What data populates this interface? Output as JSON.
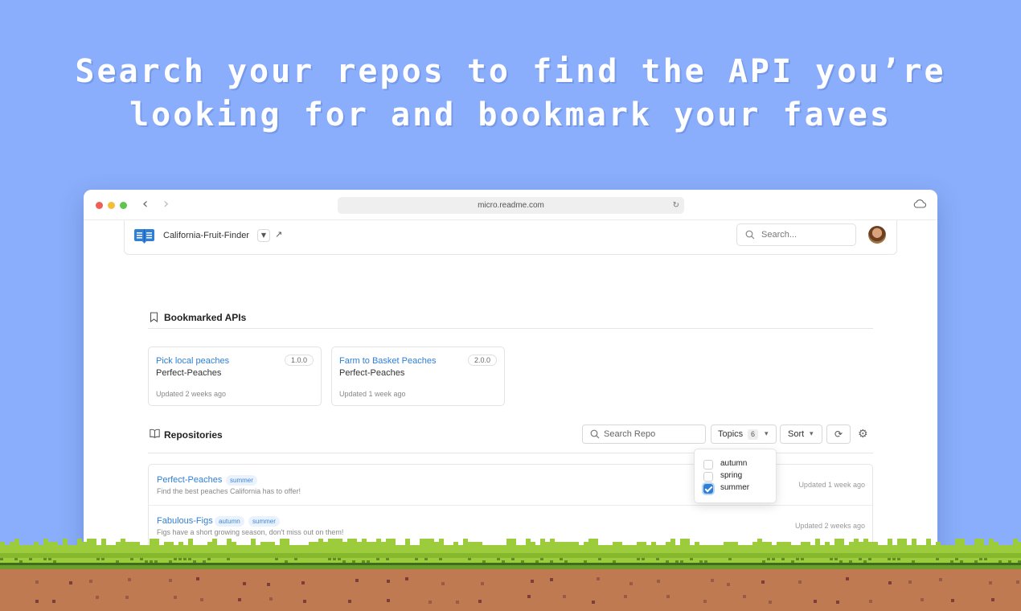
{
  "hero": {
    "line1": "Search your repos to find the API you’re",
    "line2": "looking for and bookmark your faves"
  },
  "browser": {
    "url": "micro.readme.com"
  },
  "app": {
    "project_name": "California-Fruit-Finder",
    "search_placeholder": "Search..."
  },
  "bookmarks": {
    "heading": "Bookmarked APIs",
    "cards": [
      {
        "title": "Pick local peaches",
        "repo": "Perfect-Peaches",
        "version": "1.0.0",
        "updated": "Updated 2 weeks ago"
      },
      {
        "title": "Farm to Basket Peaches",
        "repo": "Perfect-Peaches",
        "version": "2.0.0",
        "updated": "Updated 1 week ago"
      }
    ]
  },
  "repositories": {
    "heading": "Repositories",
    "search_placeholder": "Search Repo",
    "topics_label": "Topics",
    "topics_count": "6",
    "sort_label": "Sort",
    "topic_options": [
      {
        "label": "autumn",
        "checked": false
      },
      {
        "label": "spring",
        "checked": false
      },
      {
        "label": "summer",
        "checked": true
      }
    ],
    "rows": [
      {
        "name": "Perfect-Peaches",
        "tags": [
          "summer"
        ],
        "description": "Find the best peaches California has to offer!",
        "updated": "Updated 1 week ago"
      },
      {
        "name": "Fabulous-Figs",
        "tags": [
          "autumn",
          "summer"
        ],
        "description": "Figs have a short growing season, don't miss out on them!",
        "updated": "Updated 2 weeks ago"
      }
    ]
  },
  "colors": {
    "background": "#8aaefb",
    "accent": "#2f7fd6",
    "grass": "#9ccc3c",
    "dirt": "#c07a52"
  },
  "icons": {
    "logo": "readme-book-icon",
    "bookmark": "bookmark-icon",
    "book": "book-open-icon",
    "search": "search-icon",
    "refresh": "refresh-icon",
    "settings": "gear-icon",
    "cloud": "cloud-icon"
  }
}
